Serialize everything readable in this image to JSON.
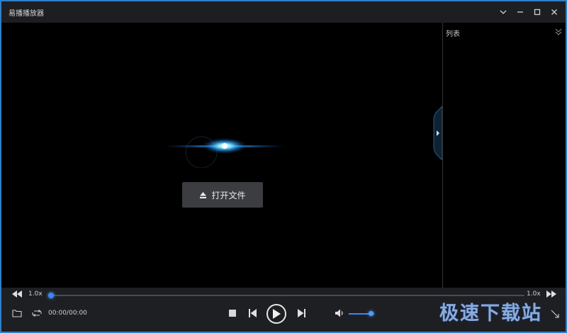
{
  "window": {
    "title": "易播播放器"
  },
  "video": {
    "open_button_label": "打开文件"
  },
  "playlist": {
    "title": "列表"
  },
  "controls": {
    "speed_left": "1.0x",
    "speed_right": "1.0x",
    "timecode": "00:00/00:00",
    "progress": 0.0,
    "volume": 0.85
  },
  "watermark": "极速下载站",
  "colors": {
    "accent": "#3a86ff",
    "titlebar": "#1d1e22",
    "control_bar": "#1e1f23"
  }
}
